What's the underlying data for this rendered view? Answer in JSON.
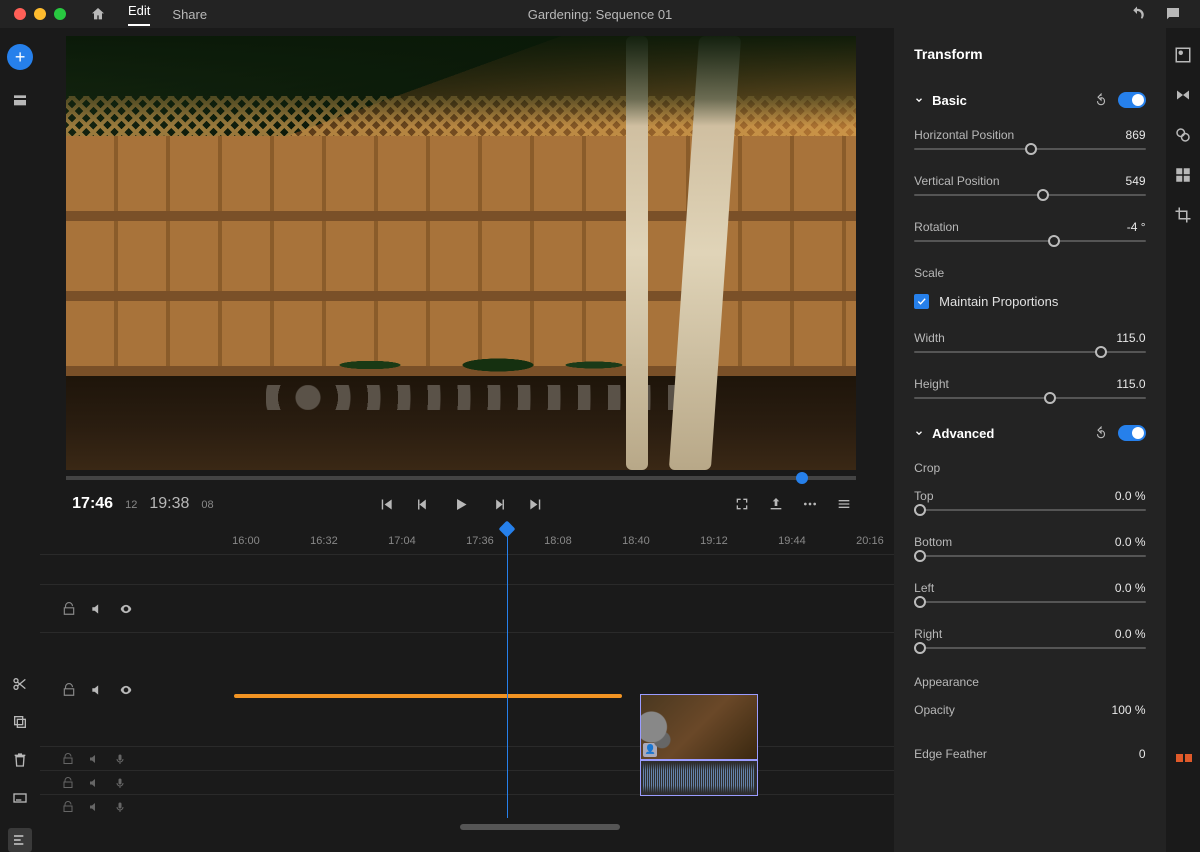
{
  "title": "Gardening: Sequence 01",
  "nav": {
    "edit": "Edit",
    "share": "Share"
  },
  "transport": {
    "current": "17:46",
    "current_frames": "12",
    "duration": "19:38",
    "duration_frames": "08"
  },
  "ruler": [
    "16:00",
    "16:32",
    "17:04",
    "17:36",
    "18:08",
    "18:40",
    "19:12",
    "19:44",
    "20:16"
  ],
  "panel": {
    "title": "Transform",
    "basic": {
      "label": "Basic",
      "hpos": {
        "label": "Horizontal Position",
        "value": "869",
        "pct": 48
      },
      "vpos": {
        "label": "Vertical Position",
        "value": "549",
        "pct": 53
      },
      "rotation": {
        "label": "Rotation",
        "value": "-4 °",
        "pct": 58
      },
      "scale_label": "Scale",
      "maintain": "Maintain Proportions",
      "width": {
        "label": "Width",
        "value": "115.0",
        "pct": 78
      },
      "height": {
        "label": "Height",
        "value": "115.0",
        "pct": 56
      }
    },
    "advanced": {
      "label": "Advanced",
      "crop_label": "Crop",
      "top": {
        "label": "Top",
        "value": "0.0 %",
        "pct": 0
      },
      "bottom": {
        "label": "Bottom",
        "value": "0.0 %",
        "pct": 0
      },
      "left": {
        "label": "Left",
        "value": "0.0 %",
        "pct": 0
      },
      "right": {
        "label": "Right",
        "value": "0.0 %",
        "pct": 0
      },
      "appearance_label": "Appearance",
      "opacity": {
        "label": "Opacity",
        "value": "100 %"
      },
      "edge": {
        "label": "Edge Feather",
        "value": "0"
      }
    }
  }
}
